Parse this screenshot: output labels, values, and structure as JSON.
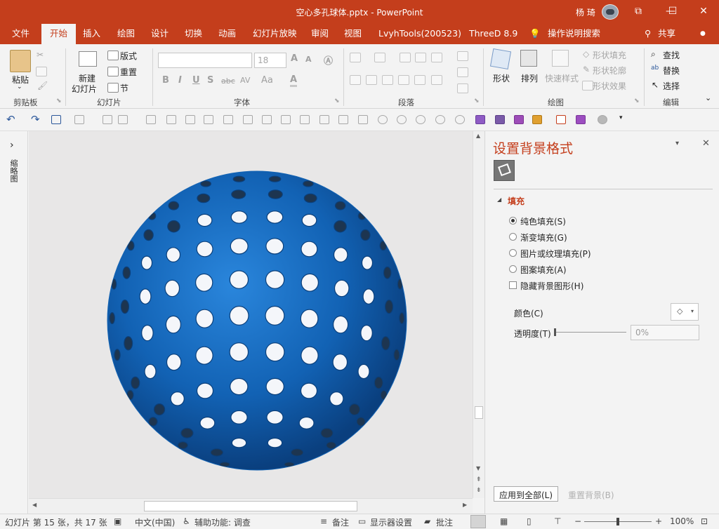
{
  "window": {
    "title": "空心多孔球体.pptx  -  PowerPoint",
    "user": "杨 琦",
    "minimize": "—",
    "maximize": "☐",
    "close": "✕",
    "restore_ribbon": "⧉"
  },
  "tabs": [
    "文件",
    "开始",
    "插入",
    "绘图",
    "设计",
    "切换",
    "动画",
    "幻灯片放映",
    "审阅",
    "视图",
    "LvyhTools(200523)",
    "ThreeD 8.9",
    "操作说明搜索"
  ],
  "share": "共享",
  "ribbon": {
    "clipboard": {
      "paste": "粘贴",
      "label": "剪贴板"
    },
    "slides": {
      "new_slide_line1": "新建",
      "new_slide_line2": "幻灯片",
      "layout": "版式",
      "reset": "重置",
      "section": "节",
      "label": "幻灯片"
    },
    "font": {
      "font_name": "",
      "font_size": "18",
      "bold": "B",
      "italic": "I",
      "underline": "U",
      "shadow": "S",
      "strike": "abc",
      "spacing": "AV",
      "case": "Aa",
      "color": "A",
      "grow": "A",
      "shrink": "A",
      "label": "字体"
    },
    "paragraph": {
      "label": "段落"
    },
    "drawing": {
      "shapes": "形状",
      "arrange": "排列",
      "quick_styles": "快速样式",
      "shape_fill": "形状填充",
      "shape_outline": "形状轮廓",
      "shape_effects": "形状效果",
      "label": "绘图"
    },
    "editing": {
      "find": "查找",
      "replace": "替换",
      "select": "选择",
      "label": "编辑"
    }
  },
  "left_pane": {
    "label": "缩略图",
    "expand": "›"
  },
  "canvas": {
    "sphere_color": "#1464b4"
  },
  "format_pane": {
    "title": "设置背景格式",
    "section": "填充",
    "options": [
      {
        "label": "纯色填充(S)",
        "selected": true
      },
      {
        "label": "渐变填充(G)",
        "selected": false
      },
      {
        "label": "图片或纹理填充(P)",
        "selected": false
      },
      {
        "label": "图案填充(A)",
        "selected": false
      }
    ],
    "hide_bg_graphics": "隐藏背景图形(H)",
    "color_label": "颜色(C)",
    "transparency_label": "透明度(T)",
    "transparency_value": "0%",
    "apply_all": "应用到全部(L)",
    "reset_bg": "重置背景(B)"
  },
  "status": {
    "slide_info": "幻灯片 第 15 张，共 17 张",
    "language": "中文(中国)",
    "accessibility": "辅助功能: 调查",
    "notes": "备注",
    "display_settings": "显示器设置",
    "comments": "批注",
    "zoom": "100%"
  }
}
